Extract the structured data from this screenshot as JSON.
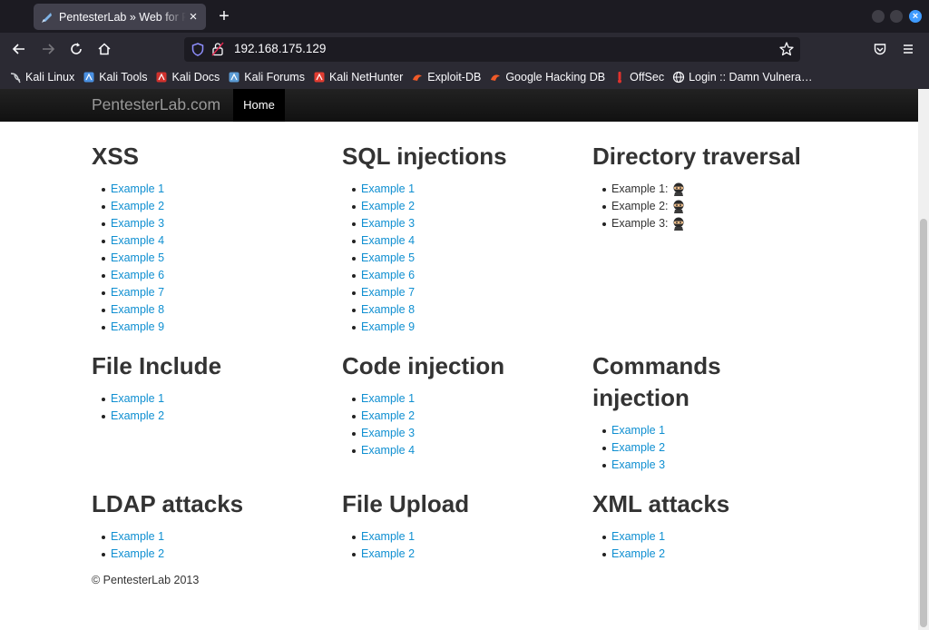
{
  "browser": {
    "tab_title": "PentesterLab » Web for Pentester",
    "new_tab": "+",
    "close_tab": "×",
    "url": "192.168.175.129"
  },
  "bookmarks": [
    {
      "label": "Kali Linux",
      "icon": "kali-dragon-icon",
      "color": "#cfd2d6"
    },
    {
      "label": "Kali Tools",
      "icon": "kali-tools-icon",
      "color": "#4a90e2"
    },
    {
      "label": "Kali Docs",
      "icon": "kali-docs-icon",
      "color": "#d0312d"
    },
    {
      "label": "Kali Forums",
      "icon": "kali-forums-icon",
      "color": "#5b9bd5"
    },
    {
      "label": "Kali NetHunter",
      "icon": "nethunter-icon",
      "color": "#e03c31"
    },
    {
      "label": "Exploit-DB",
      "icon": "exploit-db-icon",
      "color": "#f05a28"
    },
    {
      "label": "Google Hacking DB",
      "icon": "ghdb-icon",
      "color": "#f05a28"
    },
    {
      "label": "OffSec",
      "icon": "offsec-icon",
      "color": "#e0322d"
    },
    {
      "label": "Login :: Damn Vulnera…",
      "icon": "globe-icon",
      "color": "#fbfbfe"
    }
  ],
  "site": {
    "brand": "PentesterLab.com",
    "nav_home": "Home",
    "footer": "© PentesterLab 2013"
  },
  "sections": [
    {
      "title": "XSS",
      "items": [
        "Example 1",
        "Example 2",
        "Example 3",
        "Example 4",
        "Example 5",
        "Example 6",
        "Example 7",
        "Example 8",
        "Example 9"
      ]
    },
    {
      "title": "SQL injections",
      "items": [
        "Example 1",
        "Example 2",
        "Example 3",
        "Example 4",
        "Example 5",
        "Example 6",
        "Example 7",
        "Example 8",
        "Example 9"
      ]
    },
    {
      "title": "Directory traversal",
      "items": [
        "Example 1:",
        "Example 2:",
        "Example 3:"
      ]
    },
    {
      "title": "File Include",
      "items": [
        "Example 1",
        "Example 2"
      ]
    },
    {
      "title": "Code injection",
      "items": [
        "Example 1",
        "Example 2",
        "Example 3",
        "Example 4"
      ]
    },
    {
      "title": "Commands injection",
      "items": [
        "Example 1",
        "Example 2",
        "Example 3"
      ]
    },
    {
      "title": "LDAP attacks",
      "items": [
        "Example 1",
        "Example 2"
      ]
    },
    {
      "title": "File Upload",
      "items": [
        "Example 1",
        "Example 2"
      ]
    },
    {
      "title": "XML attacks",
      "items": [
        "Example 1",
        "Example 2"
      ]
    }
  ],
  "colors": {
    "link": "#0f8fd1",
    "heading": "#333333",
    "chrome_bg": "#1c1b22",
    "toolbar_bg": "#2b2a33"
  }
}
